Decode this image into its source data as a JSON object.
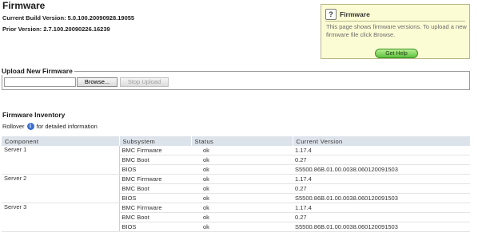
{
  "page": {
    "title": "Firmware",
    "current_build": "Current Build Version: 5.0.100.20090928.19055",
    "prior_version": "Prior Version: 2.7.100.20090226.16239"
  },
  "help": {
    "title": "Firmware",
    "text": "This page shows firmware versions. To upload a new firmware file click Browse.",
    "button": "Get Help"
  },
  "upload": {
    "legend": "Upload New Firmware",
    "browse_label": "Browse...",
    "stop_label": "Stop Upload"
  },
  "inventory": {
    "title": "Firmware Inventory",
    "rollover_before": "Rollover",
    "rollover_after": "for detailed information",
    "columns": [
      "Component",
      "Subsystem",
      "Status",
      "Current Version"
    ],
    "groups": [
      {
        "component": "Server 1",
        "rows": [
          {
            "subsystem": "BMC Firmware",
            "status": "ok",
            "version": "1.17.4"
          },
          {
            "subsystem": "BMC Boot",
            "status": "ok",
            "version": "0.27"
          },
          {
            "subsystem": "BIOS",
            "status": "ok",
            "version": "S5500.86B.01.00.0038.060120091503"
          }
        ]
      },
      {
        "component": "Server 2",
        "rows": [
          {
            "subsystem": "BMC Firmware",
            "status": "ok",
            "version": "1.17.4"
          },
          {
            "subsystem": "BMC Boot",
            "status": "ok",
            "version": "0.27"
          },
          {
            "subsystem": "BIOS",
            "status": "ok",
            "version": "S5500.86B.01.00.0038.060120091503"
          }
        ]
      },
      {
        "component": "Server 3",
        "rows": [
          {
            "subsystem": "BMC Firmware",
            "status": "ok",
            "version": "1.17.4"
          },
          {
            "subsystem": "BMC Boot",
            "status": "ok",
            "version": "0.27"
          },
          {
            "subsystem": "BIOS",
            "status": "ok",
            "version": "S5500.86B.01.00.0038.060120091503"
          }
        ]
      }
    ]
  },
  "colors": {
    "help_bg": "#fcfcd4",
    "help_button": "#5fc23f",
    "table_header": "#dde3ea",
    "info_icon": "#3b6fd0"
  },
  "icons": {
    "help": "question-mark-icon",
    "info": "info-icon"
  }
}
